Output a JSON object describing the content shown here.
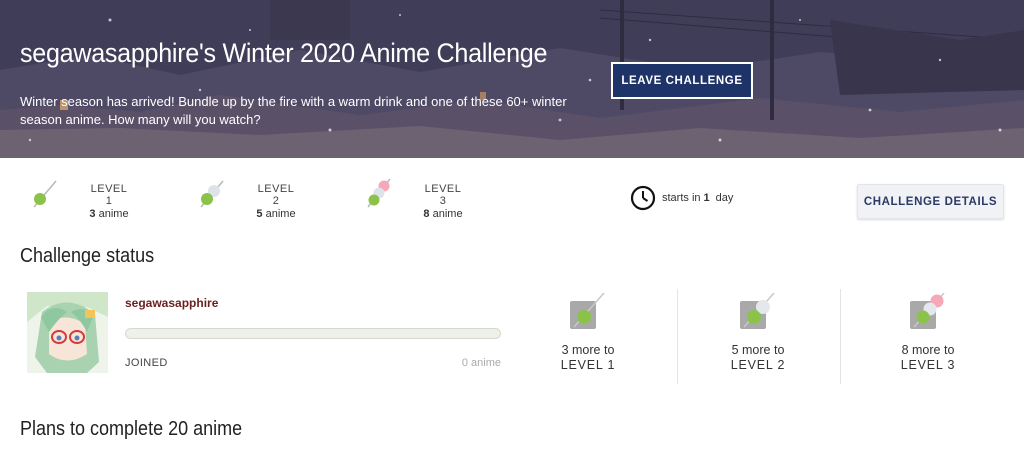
{
  "hero": {
    "title": "segawasapphire's Winter 2020 Anime Challenge",
    "description": "Winter season has arrived! Bundle up by the fire with a warm drink and one of these 60+ winter season anime. How many will you watch?",
    "leave_label": "LEAVE CHALLENGE"
  },
  "levels": [
    {
      "label": "LEVEL 1",
      "count": "3",
      "unit": "anime"
    },
    {
      "label": "LEVEL 2",
      "count": "5",
      "unit": "anime"
    },
    {
      "label": "LEVEL 3",
      "count": "8",
      "unit": "anime"
    }
  ],
  "starts": {
    "prefix": "starts in",
    "value": "1",
    "suffix": "day"
  },
  "details_label": "CHALLENGE DETAILS",
  "status": {
    "title": "Challenge status",
    "username": "segawasapphire",
    "progress": 0,
    "state": "JOINED",
    "anime_count": "0 anime",
    "goals": [
      {
        "more": "3 more to",
        "level": "LEVEL 1"
      },
      {
        "more": "5 more to",
        "level": "LEVEL 2"
      },
      {
        "more": "8 more to",
        "level": "LEVEL 3"
      }
    ]
  },
  "plans": {
    "title": "Plans to complete 20 anime"
  },
  "colors": {
    "brand_navy": "#1e3367",
    "dango_green": "#8bc34a",
    "username": "#6b1f1f"
  }
}
